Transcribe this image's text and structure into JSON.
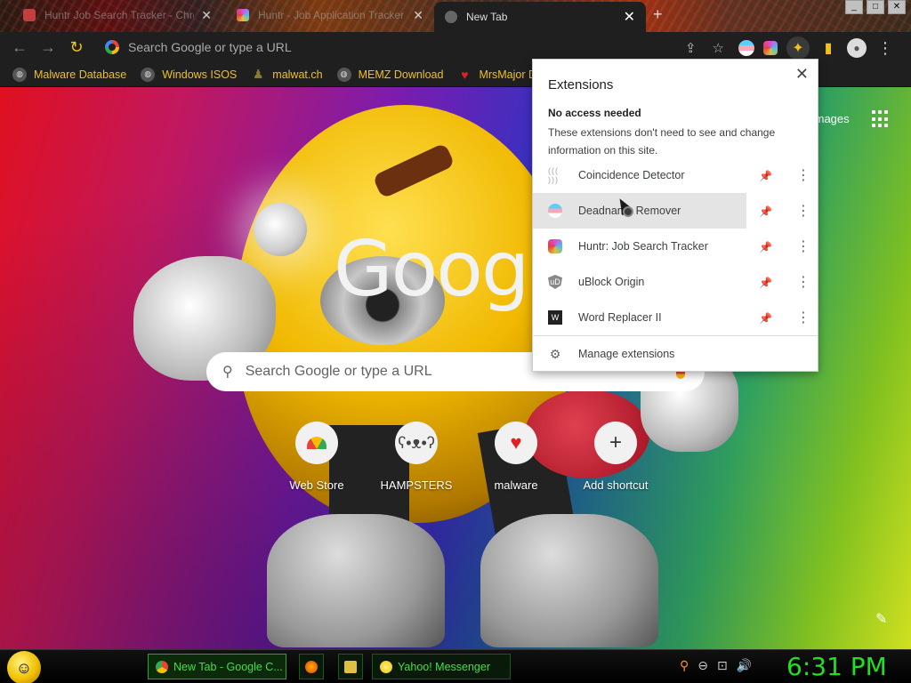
{
  "browser": {
    "tabs": [
      {
        "title": "Huntr Job Search Tracker - Chro",
        "active": false
      },
      {
        "title": "Huntr - Job Application Tracker",
        "active": false
      },
      {
        "title": "New Tab",
        "active": true
      }
    ],
    "omnibox_placeholder": "Search Google or type a URL",
    "bookmarks": [
      {
        "label": "Malware Database"
      },
      {
        "label": "Windows ISOS"
      },
      {
        "label": "malwat.ch"
      },
      {
        "label": "MEMZ Download"
      },
      {
        "label": "MrsMajor Dow"
      }
    ]
  },
  "ntp": {
    "logo_text": "Google",
    "images_link": "Images",
    "search_placeholder": "Search Google or type a URL",
    "shortcuts": [
      {
        "label": "Web Store",
        "icon": "chrome-web-store-icon"
      },
      {
        "label": "HAMPSTERS",
        "icon": "hamster-icon"
      },
      {
        "label": "malware",
        "icon": "heart-icon"
      },
      {
        "label": "Add shortcut",
        "icon": "plus-icon"
      }
    ]
  },
  "extensions_popup": {
    "title": "Extensions",
    "section_title": "No access needed",
    "section_desc": "These extensions don't need to see and change information on this site.",
    "items": [
      {
        "name": "Coincidence Detector",
        "pinned": false
      },
      {
        "name": "Deadname Remover",
        "pinned": true
      },
      {
        "name": "Huntr: Job Search Tracker",
        "pinned": true
      },
      {
        "name": "uBlock Origin",
        "pinned": false
      },
      {
        "name": "Word Replacer II",
        "pinned": false
      }
    ],
    "manage_label": "Manage extensions"
  },
  "taskbar": {
    "buttons": [
      {
        "label": "New Tab - Google C..."
      },
      {
        "label": "Yahoo! Messenger"
      }
    ],
    "clock": "6:31 PM"
  },
  "colors": {
    "accent_yellow": "#f0c020",
    "clock_green": "#20e020",
    "pin_blue": "#1a73e8"
  }
}
